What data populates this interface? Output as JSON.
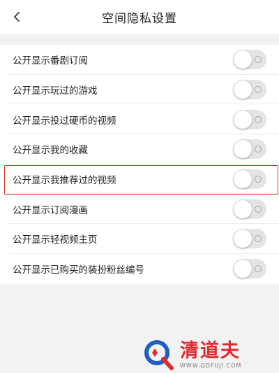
{
  "header": {
    "title": "空间隐私设置",
    "back_icon": "chevron-left-icon"
  },
  "settings": [
    {
      "label": "公开显示番剧订阅",
      "enabled": false
    },
    {
      "label": "公开显示玩过的游戏",
      "enabled": false
    },
    {
      "label": "公开显示投过硬币的视频",
      "enabled": false
    },
    {
      "label": "公开显示我的收藏",
      "enabled": false
    },
    {
      "label": "公开显示我推荐过的视频",
      "enabled": false,
      "highlighted": true
    },
    {
      "label": "公开显示订阅漫画",
      "enabled": false
    },
    {
      "label": "公开显示轻视频主页",
      "enabled": false
    },
    {
      "label": "公开显示已购买的装扮粉丝编号",
      "enabled": false
    }
  ],
  "watermark": {
    "brand": "清道夫",
    "url": "WWW.QDFUJI.COM"
  },
  "colors": {
    "highlight_border": "#d9342b",
    "toggle_track_off": "#e4e4e4",
    "watermark_red": "#e0282f",
    "watermark_blue": "#1f5fc4"
  }
}
